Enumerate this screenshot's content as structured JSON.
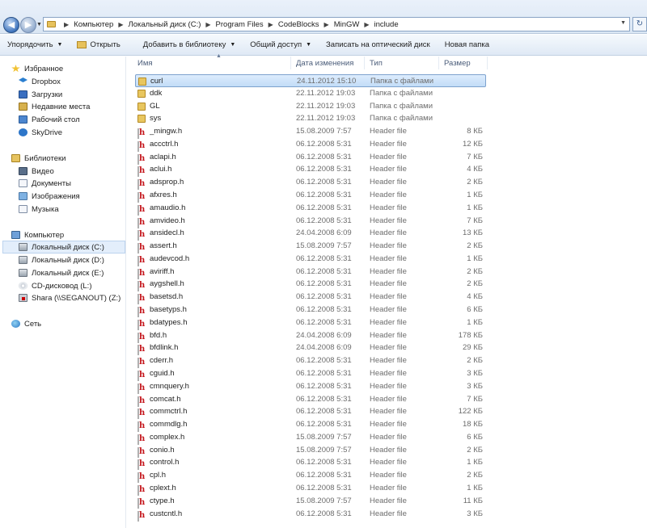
{
  "address": {
    "crumbs": [
      "Компьютер",
      "Локальный диск (C:)",
      "Program Files",
      "CodeBlocks",
      "MinGW",
      "include"
    ]
  },
  "toolbar": {
    "organize": "Упорядочить",
    "open": "Открыть",
    "add_to_library": "Добавить в библиотеку",
    "share": "Общий доступ",
    "burn": "Записать на оптический диск",
    "new_folder": "Новая папка"
  },
  "sidebar": {
    "favorites": {
      "label": "Избранное",
      "items": [
        "Dropbox",
        "Загрузки",
        "Недавние места",
        "Рабочий стол",
        "SkyDrive"
      ]
    },
    "libraries": {
      "label": "Библиотеки",
      "items": [
        "Видео",
        "Документы",
        "Изображения",
        "Музыка"
      ]
    },
    "computer": {
      "label": "Компьютер",
      "items": [
        "Локальный диск (C:)",
        "Локальный диск (D:)",
        "Локальный диск (E:)",
        "CD-дисковод (L:)",
        "Shara (\\\\SEGANOUT) (Z:)"
      ],
      "selected_index": 0
    },
    "network": {
      "label": "Сеть"
    }
  },
  "columns": {
    "name": "Имя",
    "date": "Дата изменения",
    "type": "Тип",
    "size": "Размер"
  },
  "files": [
    {
      "name": "curl",
      "date": "24.11.2012 15:10",
      "type": "Папка с файлами",
      "size": "",
      "kind": "folder"
    },
    {
      "name": "ddk",
      "date": "22.11.2012 19:03",
      "type": "Папка с файлами",
      "size": "",
      "kind": "folder"
    },
    {
      "name": "GL",
      "date": "22.11.2012 19:03",
      "type": "Папка с файлами",
      "size": "",
      "kind": "folder"
    },
    {
      "name": "sys",
      "date": "22.11.2012 19:03",
      "type": "Папка с файлами",
      "size": "",
      "kind": "folder"
    },
    {
      "name": "_mingw.h",
      "date": "15.08.2009 7:57",
      "type": "Header file",
      "size": "8 КБ",
      "kind": "h"
    },
    {
      "name": "accctrl.h",
      "date": "06.12.2008 5:31",
      "type": "Header file",
      "size": "12 КБ",
      "kind": "h"
    },
    {
      "name": "aclapi.h",
      "date": "06.12.2008 5:31",
      "type": "Header file",
      "size": "7 КБ",
      "kind": "h"
    },
    {
      "name": "aclui.h",
      "date": "06.12.2008 5:31",
      "type": "Header file",
      "size": "4 КБ",
      "kind": "h"
    },
    {
      "name": "adsprop.h",
      "date": "06.12.2008 5:31",
      "type": "Header file",
      "size": "2 КБ",
      "kind": "h"
    },
    {
      "name": "afxres.h",
      "date": "06.12.2008 5:31",
      "type": "Header file",
      "size": "1 КБ",
      "kind": "h"
    },
    {
      "name": "amaudio.h",
      "date": "06.12.2008 5:31",
      "type": "Header file",
      "size": "1 КБ",
      "kind": "h"
    },
    {
      "name": "amvideo.h",
      "date": "06.12.2008 5:31",
      "type": "Header file",
      "size": "7 КБ",
      "kind": "h"
    },
    {
      "name": "ansidecl.h",
      "date": "24.04.2008 6:09",
      "type": "Header file",
      "size": "13 КБ",
      "kind": "h"
    },
    {
      "name": "assert.h",
      "date": "15.08.2009 7:57",
      "type": "Header file",
      "size": "2 КБ",
      "kind": "h"
    },
    {
      "name": "audevcod.h",
      "date": "06.12.2008 5:31",
      "type": "Header file",
      "size": "1 КБ",
      "kind": "h"
    },
    {
      "name": "aviriff.h",
      "date": "06.12.2008 5:31",
      "type": "Header file",
      "size": "2 КБ",
      "kind": "h"
    },
    {
      "name": "aygshell.h",
      "date": "06.12.2008 5:31",
      "type": "Header file",
      "size": "2 КБ",
      "kind": "h"
    },
    {
      "name": "basetsd.h",
      "date": "06.12.2008 5:31",
      "type": "Header file",
      "size": "4 КБ",
      "kind": "h"
    },
    {
      "name": "basetyps.h",
      "date": "06.12.2008 5:31",
      "type": "Header file",
      "size": "6 КБ",
      "kind": "h"
    },
    {
      "name": "bdatypes.h",
      "date": "06.12.2008 5:31",
      "type": "Header file",
      "size": "1 КБ",
      "kind": "h"
    },
    {
      "name": "bfd.h",
      "date": "24.04.2008 6:09",
      "type": "Header file",
      "size": "178 КБ",
      "kind": "h"
    },
    {
      "name": "bfdlink.h",
      "date": "24.04.2008 6:09",
      "type": "Header file",
      "size": "29 КБ",
      "kind": "h"
    },
    {
      "name": "cderr.h",
      "date": "06.12.2008 5:31",
      "type": "Header file",
      "size": "2 КБ",
      "kind": "h"
    },
    {
      "name": "cguid.h",
      "date": "06.12.2008 5:31",
      "type": "Header file",
      "size": "3 КБ",
      "kind": "h"
    },
    {
      "name": "cmnquery.h",
      "date": "06.12.2008 5:31",
      "type": "Header file",
      "size": "3 КБ",
      "kind": "h"
    },
    {
      "name": "comcat.h",
      "date": "06.12.2008 5:31",
      "type": "Header file",
      "size": "7 КБ",
      "kind": "h"
    },
    {
      "name": "commctrl.h",
      "date": "06.12.2008 5:31",
      "type": "Header file",
      "size": "122 КБ",
      "kind": "h"
    },
    {
      "name": "commdlg.h",
      "date": "06.12.2008 5:31",
      "type": "Header file",
      "size": "18 КБ",
      "kind": "h"
    },
    {
      "name": "complex.h",
      "date": "15.08.2009 7:57",
      "type": "Header file",
      "size": "6 КБ",
      "kind": "h"
    },
    {
      "name": "conio.h",
      "date": "15.08.2009 7:57",
      "type": "Header file",
      "size": "2 КБ",
      "kind": "h"
    },
    {
      "name": "control.h",
      "date": "06.12.2008 5:31",
      "type": "Header file",
      "size": "1 КБ",
      "kind": "h"
    },
    {
      "name": "cpl.h",
      "date": "06.12.2008 5:31",
      "type": "Header file",
      "size": "2 КБ",
      "kind": "h"
    },
    {
      "name": "cplext.h",
      "date": "06.12.2008 5:31",
      "type": "Header file",
      "size": "1 КБ",
      "kind": "h"
    },
    {
      "name": "ctype.h",
      "date": "15.08.2009 7:57",
      "type": "Header file",
      "size": "11 КБ",
      "kind": "h"
    },
    {
      "name": "custcntl.h",
      "date": "06.12.2008 5:31",
      "type": "Header file",
      "size": "3 КБ",
      "kind": "h"
    }
  ],
  "selected_file_index": 0
}
